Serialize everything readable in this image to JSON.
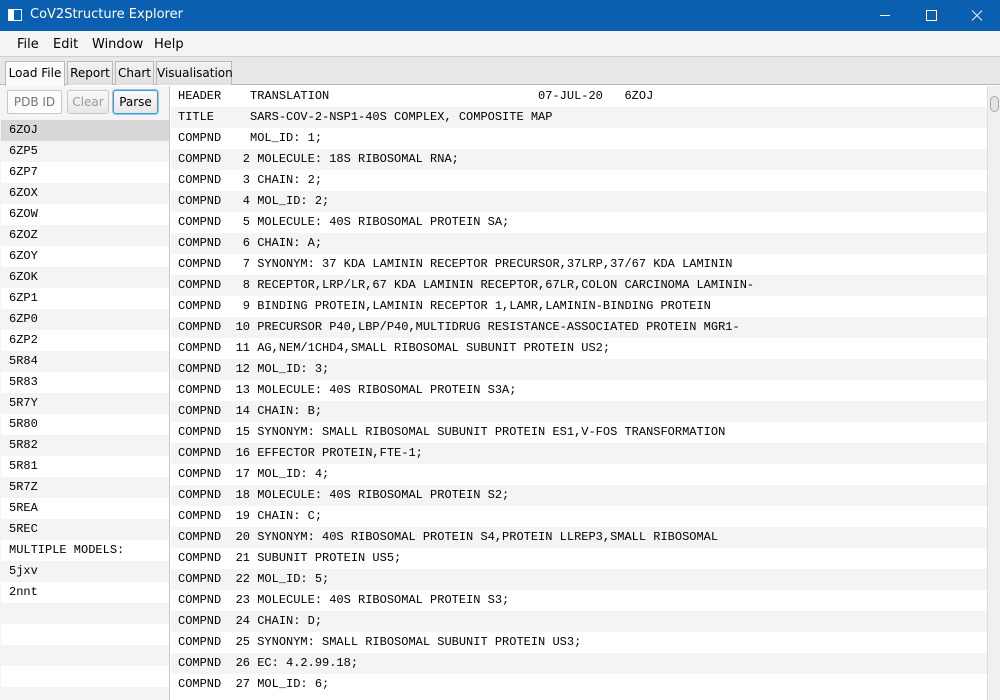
{
  "window": {
    "title": "CoV2Structure Explorer"
  },
  "menu": [
    "File",
    "Edit",
    "Window",
    "Help"
  ],
  "tabs": [
    "Load File",
    "Report",
    "Chart",
    "Visualisation"
  ],
  "toolbar": {
    "pdb_placeholder": "PDB ID",
    "clear_label": "Clear",
    "parse_label": "Parse"
  },
  "list_items": [
    "6ZOJ",
    "6ZP5",
    "6ZP7",
    "6ZOX",
    "6ZOW",
    "6ZOZ",
    "6ZOY",
    "6ZOK",
    "6ZP1",
    "6ZP0",
    "6ZP2",
    "5R84",
    "5R83",
    "5R7Y",
    "5R80",
    "5R82",
    "5R81",
    "5R7Z",
    "5REA",
    "5REC",
    "MULTIPLE MODELS:",
    "5jxv",
    "2nnt",
    "",
    "",
    "",
    "",
    "",
    ""
  ],
  "file_lines": [
    "HEADER    TRANSLATION                             07-JUL-20   6ZOJ",
    "TITLE     SARS-COV-2-NSP1-40S COMPLEX, COMPOSITE MAP",
    "COMPND    MOL_ID: 1;",
    "COMPND   2 MOLECULE: 18S RIBOSOMAL RNA;",
    "COMPND   3 CHAIN: 2;",
    "COMPND   4 MOL_ID: 2;",
    "COMPND   5 MOLECULE: 40S RIBOSOMAL PROTEIN SA;",
    "COMPND   6 CHAIN: A;",
    "COMPND   7 SYNONYM: 37 KDA LAMININ RECEPTOR PRECURSOR,37LRP,37/67 KDA LAMININ",
    "COMPND   8 RECEPTOR,LRP/LR,67 KDA LAMININ RECEPTOR,67LR,COLON CARCINOMA LAMININ-",
    "COMPND   9 BINDING PROTEIN,LAMININ RECEPTOR 1,LAMR,LAMININ-BINDING PROTEIN",
    "COMPND  10 PRECURSOR P40,LBP/P40,MULTIDRUG RESISTANCE-ASSOCIATED PROTEIN MGR1-",
    "COMPND  11 AG,NEM/1CHD4,SMALL RIBOSOMAL SUBUNIT PROTEIN US2;",
    "COMPND  12 MOL_ID: 3;",
    "COMPND  13 MOLECULE: 40S RIBOSOMAL PROTEIN S3A;",
    "COMPND  14 CHAIN: B;",
    "COMPND  15 SYNONYM: SMALL RIBOSOMAL SUBUNIT PROTEIN ES1,V-FOS TRANSFORMATION",
    "COMPND  16 EFFECTOR PROTEIN,FTE-1;",
    "COMPND  17 MOL_ID: 4;",
    "COMPND  18 MOLECULE: 40S RIBOSOMAL PROTEIN S2;",
    "COMPND  19 CHAIN: C;",
    "COMPND  20 SYNONYM: 40S RIBOSOMAL PROTEIN S4,PROTEIN LLREP3,SMALL RIBOSOMAL",
    "COMPND  21 SUBUNIT PROTEIN US5;",
    "COMPND  22 MOL_ID: 5;",
    "COMPND  23 MOLECULE: 40S RIBOSOMAL PROTEIN S3;",
    "COMPND  24 CHAIN: D;",
    "COMPND  25 SYNONYM: SMALL RIBOSOMAL SUBUNIT PROTEIN US3;",
    "COMPND  26 EC: 4.2.99.18;",
    "COMPND  27 MOL_ID: 6;"
  ]
}
